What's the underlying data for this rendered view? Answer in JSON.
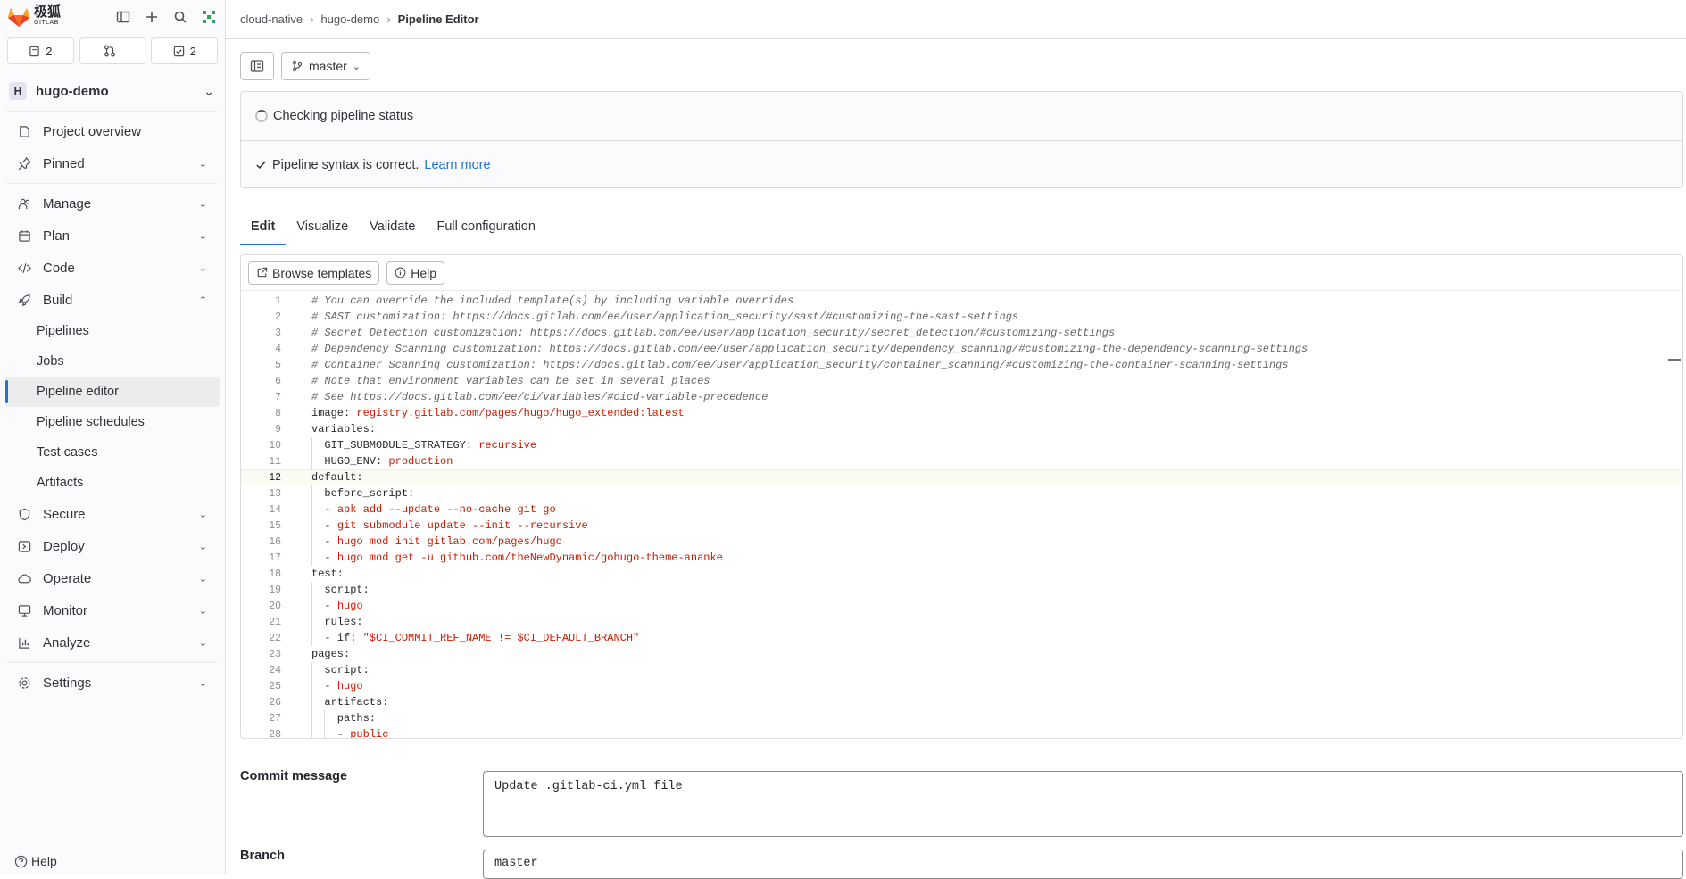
{
  "brand": {
    "name_cn": "极狐",
    "name_en": "GITLAB"
  },
  "counters": [
    {
      "icon": "issues-icon",
      "count": "2"
    },
    {
      "icon": "merge-request-icon",
      "count": ""
    },
    {
      "icon": "todo-icon",
      "count": "2"
    }
  ],
  "project": {
    "initial": "H",
    "name": "hugo-demo"
  },
  "nav": {
    "project_overview": "Project overview",
    "pinned": "Pinned",
    "manage": "Manage",
    "plan": "Plan",
    "code": "Code",
    "build": "Build",
    "build_items": [
      "Pipelines",
      "Jobs",
      "Pipeline editor",
      "Pipeline schedules",
      "Test cases",
      "Artifacts"
    ],
    "secure": "Secure",
    "deploy": "Deploy",
    "operate": "Operate",
    "monitor": "Monitor",
    "analyze": "Analyze",
    "settings": "Settings",
    "help": "Help"
  },
  "breadcrumb": [
    "cloud-native",
    "hugo-demo",
    "Pipeline Editor"
  ],
  "branch_select": "master",
  "status": {
    "checking": "Checking pipeline status",
    "syntax": "Pipeline syntax is correct.",
    "learn_more": "Learn more"
  },
  "tabs": [
    "Edit",
    "Visualize",
    "Validate",
    "Full configuration"
  ],
  "editor_tools": {
    "browse": "Browse templates",
    "help": "Help"
  },
  "code_lines": [
    "# You can override the included template(s) by including variable overrides",
    "# SAST customization: https://docs.gitlab.com/ee/user/application_security/sast/#customizing-the-sast-settings",
    "# Secret Detection customization: https://docs.gitlab.com/ee/user/application_security/secret_detection/#customizing-settings",
    "# Dependency Scanning customization: https://docs.gitlab.com/ee/user/application_security/dependency_scanning/#customizing-the-dependency-scanning-settings",
    "# Container Scanning customization: https://docs.gitlab.com/ee/user/application_security/container_scanning/#customizing-the-container-scanning-settings",
    "# Note that environment variables can be set in several places",
    "# See https://docs.gitlab.com/ee/ci/variables/#cicd-variable-precedence",
    "image: registry.gitlab.com/pages/hugo/hugo_extended:latest",
    "variables:",
    "  GIT_SUBMODULE_STRATEGY: recursive",
    "  HUGO_ENV: production",
    "default:",
    "  before_script:",
    "  - apk add --update --no-cache git go",
    "  - git submodule update --init --recursive",
    "  - hugo mod init gitlab.com/pages/hugo",
    "  - hugo mod get -u github.com/theNewDynamic/gohugo-theme-ananke",
    "test:",
    "  script:",
    "  - hugo",
    "  rules:",
    "  - if: \"$CI_COMMIT_REF_NAME != $CI_DEFAULT_BRANCH\"",
    "pages:",
    "  script:",
    "  - hugo",
    "  artifacts:",
    "    paths:",
    "    - public"
  ],
  "current_line": 12,
  "commit": {
    "label": "Commit message",
    "value": "Update .gitlab-ci.yml file"
  },
  "branch": {
    "label": "Branch",
    "value": "master"
  }
}
